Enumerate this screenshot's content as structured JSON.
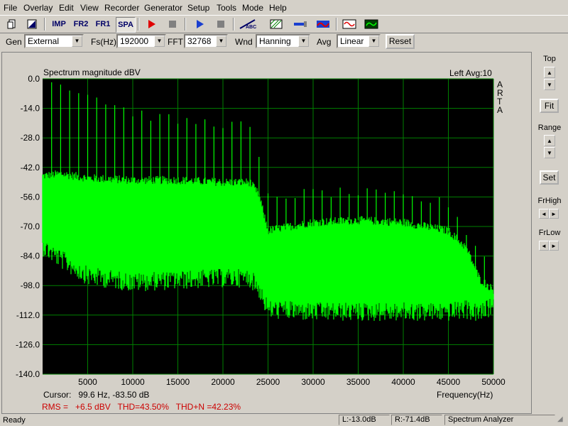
{
  "menu": [
    "File",
    "Overlay",
    "Edit",
    "View",
    "Recorder",
    "Generator",
    "Setup",
    "Tools",
    "Mode",
    "Help"
  ],
  "toolbar": {
    "buttons": [
      {
        "name": "new-document-icon",
        "label": ""
      },
      {
        "name": "edit-icon",
        "label": ""
      },
      {
        "name": "imp-mode-button",
        "label": "IMP"
      },
      {
        "name": "fr2-mode-button",
        "label": "FR2"
      },
      {
        "name": "fr1-mode-button",
        "label": "FR1"
      },
      {
        "name": "spa-mode-button",
        "label": "SPA"
      },
      {
        "name": "record-icon",
        "label": ""
      },
      {
        "name": "stop-icon",
        "label": ""
      },
      {
        "name": "play-icon",
        "label": ""
      },
      {
        "name": "stop2-icon",
        "label": ""
      },
      {
        "name": "abc-icon",
        "label": "ABC"
      },
      {
        "name": "probe-icon",
        "label": ""
      },
      {
        "name": "generator-icon",
        "label": ""
      },
      {
        "name": "waveform-icon",
        "label": ""
      },
      {
        "name": "scope-icon",
        "label": ""
      }
    ]
  },
  "controls": {
    "gen_label": "Gen",
    "gen_value": "External",
    "fs_label": "Fs(Hz)",
    "fs_value": "192000",
    "fft_label": "FFT",
    "fft_value": "32768",
    "wnd_label": "Wnd",
    "wnd_value": "Hanning",
    "avg_label": "Avg",
    "avg_value": "Linear",
    "reset_label": "Reset"
  },
  "chart_header": {
    "title": "Spectrum magnitude dBV",
    "channel": "Left  Avg:10",
    "brand": [
      "A",
      "R",
      "T",
      "A"
    ]
  },
  "chart_data": {
    "type": "line",
    "title": "Spectrum magnitude dBV",
    "xlabel": "Frequency(Hz)",
    "ylabel": "",
    "xlim": [
      0,
      50000
    ],
    "ylim": [
      -140,
      0
    ],
    "x_ticks": [
      5000,
      10000,
      15000,
      20000,
      25000,
      30000,
      35000,
      40000,
      45000,
      50000
    ],
    "y_ticks": [
      0.0,
      -14.0,
      -28.0,
      -42.0,
      -56.0,
      -70.0,
      -84.0,
      -98.0,
      -112.0,
      -126.0,
      -140.0
    ],
    "grid": true,
    "background": "#000000",
    "grid_color": "#008000",
    "series": [
      {
        "color": "#00ff00",
        "harmonic_spacing_hz": 1000,
        "envelope": {
          "x": [
            0,
            2000,
            5000,
            10000,
            15000,
            20000,
            23000,
            24000,
            25000,
            26000,
            30000,
            35000,
            40000,
            45000,
            47000,
            48500,
            50000
          ],
          "upper": [
            -46,
            -45,
            -47,
            -48,
            -48,
            -49,
            -49,
            -55,
            -72,
            -71,
            -68,
            -67,
            -68,
            -72,
            -80,
            -95,
            -100
          ],
          "lower": [
            -78,
            -84,
            -92,
            -95,
            -94,
            -93,
            -93,
            -98,
            -108,
            -108,
            -109,
            -109,
            -109,
            -109,
            -108,
            -110,
            -106
          ]
        },
        "peak_tops": {
          "x": [
            0,
            2000,
            5000,
            10000,
            15000,
            20000,
            23000,
            24000,
            25000,
            30000,
            35000,
            40000,
            45000,
            48000,
            50000
          ],
          "y": [
            -2,
            -3,
            -8,
            -17,
            -21,
            -22,
            -24,
            -40,
            -57,
            -55,
            -55,
            -57,
            -60,
            -80,
            -90
          ]
        }
      }
    ]
  },
  "readout": {
    "cursor": "Cursor:   99.6 Hz, -83.50 dB",
    "stats": "RMS =   +6.5 dBV   THD=43.50%   THD+N =42.23%"
  },
  "right_panel": {
    "top_label": "Top",
    "fit_label": "Fit",
    "range_label": "Range",
    "set_label": "Set",
    "frhigh_label": "FrHigh",
    "frlow_label": "FrLow"
  },
  "status": {
    "ready": "Ready",
    "left_level": "L:-13.0dB",
    "right_level": "R:-71.4dB",
    "mode": "Spectrum Analyzer"
  },
  "colors": {
    "plot_bg": "#000000",
    "grid": "#008000",
    "trace": "#00ff00",
    "stats_text": "#cc0000",
    "window_bg": "#d4d0c8"
  }
}
